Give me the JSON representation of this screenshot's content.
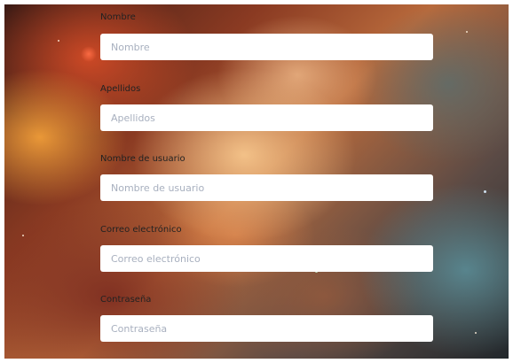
{
  "form": {
    "fields": [
      {
        "label": "Nombre",
        "placeholder": "Nombre",
        "value": ""
      },
      {
        "label": "Apellidos",
        "placeholder": "Apellidos",
        "value": ""
      },
      {
        "label": "Nombre de usuario",
        "placeholder": "Nombre de usuario",
        "value": ""
      },
      {
        "label": "Correo electrónico",
        "placeholder": "Correo electrónico",
        "value": ""
      },
      {
        "label": "Contraseña",
        "placeholder": "Contraseña",
        "value": ""
      }
    ]
  },
  "colors": {
    "input_background": "#ffffff",
    "placeholder_text": "#a8b0bf",
    "label_text": "#222222"
  }
}
